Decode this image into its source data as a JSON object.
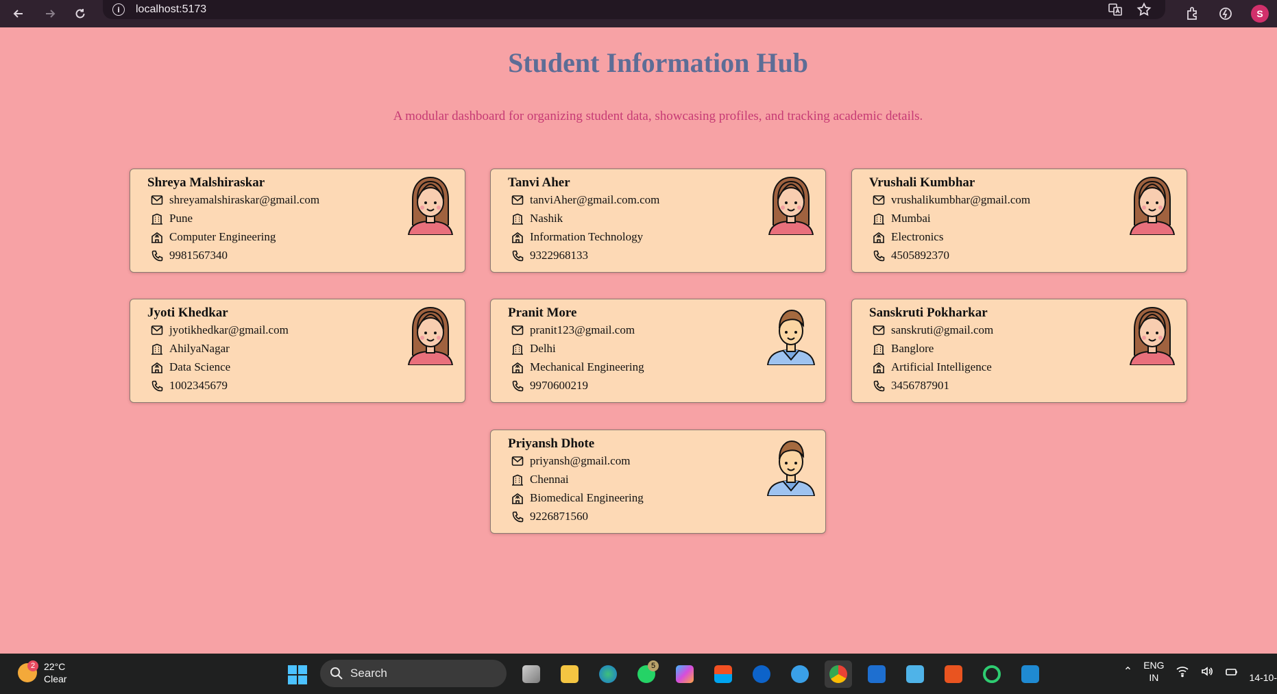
{
  "browser": {
    "url": "localhost:5173",
    "profile_initial": "S"
  },
  "page": {
    "title": "Student Information Hub",
    "subtitle": "A modular dashboard for organizing student data, showcasing profiles, and tracking academic details."
  },
  "students": [
    {
      "name": "Shreya Malshiraskar",
      "email": "shreyamalshiraskar@gmail.com",
      "city": "Pune",
      "branch": "Computer Engineering",
      "phone": "9981567340",
      "avatar": "female-avatar-icon"
    },
    {
      "name": "Tanvi Aher",
      "email": "tanviAher@gmail.com.com",
      "city": "Nashik",
      "branch": "Information Technology",
      "phone": "9322968133",
      "avatar": "female-avatar-icon"
    },
    {
      "name": "Vrushali Kumbhar",
      "email": "vrushalikumbhar@gmail.com",
      "city": "Mumbai",
      "branch": "Electronics",
      "phone": "4505892370",
      "avatar": "female-avatar-icon"
    },
    {
      "name": "Jyoti Khedkar",
      "email": "jyotikhedkar@gmail.com",
      "city": "AhilyaNagar",
      "branch": "Data Science",
      "phone": "1002345679",
      "avatar": "female-avatar-icon"
    },
    {
      "name": "Pranit More",
      "email": "pranit123@gmail.com",
      "city": "Delhi",
      "branch": "Mechanical Engineering",
      "phone": "9970600219",
      "avatar": "male-avatar-icon"
    },
    {
      "name": "Sanskruti Pokharkar",
      "email": "sanskruti@gmail.com",
      "city": "Banglore",
      "branch": "Artificial Intelligence",
      "phone": "3456787901",
      "avatar": "female-avatar-icon"
    },
    {
      "name": "Priyansh Dhote",
      "email": "priyansh@gmail.com",
      "city": "Chennai",
      "branch": "Biomedical Engineering",
      "phone": "9226871560",
      "avatar": "male-avatar-icon"
    }
  ],
  "taskbar": {
    "weather_badge": "2",
    "temperature": "22°C",
    "condition": "Clear",
    "search_placeholder": "Search",
    "whatsapp_badge": "5",
    "language": "ENG",
    "region": "IN",
    "date": "14-10-"
  },
  "colors": {
    "background": "#f7a2a5",
    "card": "#fdd9b5",
    "title": "#5d6d96",
    "subtitle": "#c63a74"
  }
}
